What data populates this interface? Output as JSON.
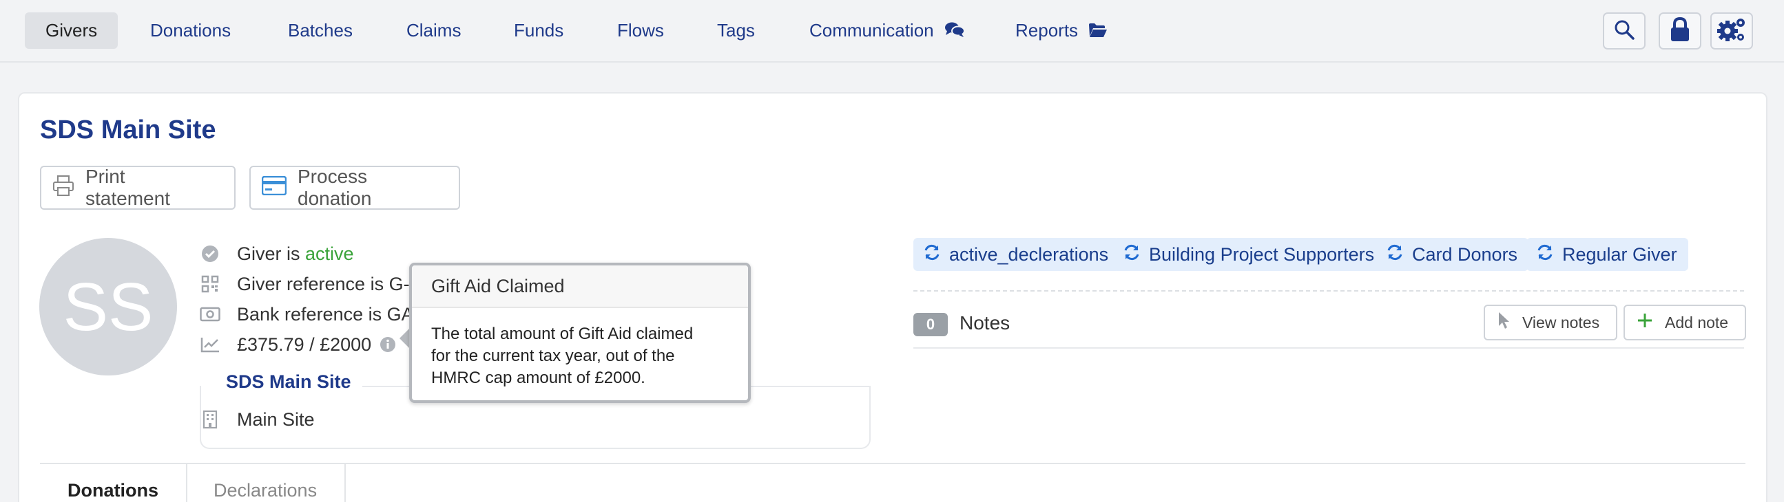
{
  "nav": {
    "items": [
      {
        "label": "Givers",
        "active": true
      },
      {
        "label": "Donations"
      },
      {
        "label": "Batches"
      },
      {
        "label": "Claims"
      },
      {
        "label": "Funds"
      },
      {
        "label": "Flows"
      },
      {
        "label": "Tags"
      },
      {
        "label": "Communication",
        "icon": "comments-icon"
      },
      {
        "label": "Reports",
        "icon": "folder-open-icon"
      }
    ],
    "right_icons": [
      "search-icon",
      "lock-icon",
      "cogs-icon"
    ]
  },
  "page": {
    "title": "SDS Main Site",
    "buttons": {
      "print": "Print statement",
      "process": "Process donation"
    }
  },
  "giver": {
    "initials": "SS",
    "status_prefix": "Giver is ",
    "status_value": "active",
    "giver_reference": "Giver reference is G-0",
    "bank_reference": "Bank reference is GA",
    "gift_aid_progress": "£375.79 / £2000"
  },
  "site": {
    "legend": "SDS Main Site",
    "name": "Main Site"
  },
  "tooltip": {
    "title": "Gift Aid Claimed",
    "body_lines": [
      "The total amount of Gift Aid claimed",
      "for the current tax year, out of the",
      "HMRC cap amount of £2000."
    ]
  },
  "tags": [
    "active_declerations",
    "Building Project Supporters",
    "Card Donors",
    "Regular Giver"
  ],
  "notes": {
    "count": "0",
    "label": "Notes",
    "view_label": "View notes",
    "add_label": "Add note"
  },
  "tabs": [
    {
      "label": "Donations",
      "active": true
    },
    {
      "label": "Declarations",
      "active": false
    }
  ],
  "colors": {
    "brand_blue": "#1f3a8a",
    "status_green": "#3aa33a",
    "tag_bg": "#e3eefc",
    "add_plus_green": "#3aa33a"
  }
}
